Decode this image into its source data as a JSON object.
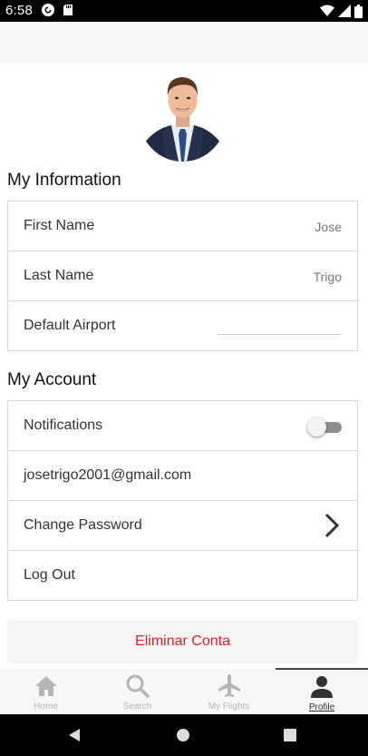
{
  "status_bar": {
    "time": "6:58",
    "left_icons": [
      "pocket-casts-icon",
      "sd-card-icon"
    ],
    "right_icons": [
      "wifi-icon",
      "signal-icon",
      "battery-icon"
    ]
  },
  "my_information": {
    "title": "My Information",
    "first_name": {
      "label": "First Name",
      "value": "Jose"
    },
    "last_name": {
      "label": "Last Name",
      "value": "Trigo"
    },
    "default_airport": {
      "label": "Default Airport",
      "value": ""
    }
  },
  "my_account": {
    "title": "My Account",
    "notifications": {
      "label": "Notifications",
      "enabled": false
    },
    "email": "josetrigo2001@gmail.com",
    "change_password": "Change Password",
    "log_out": "Log Out"
  },
  "delete_account": "Eliminar Conta",
  "tabs": [
    {
      "label": "Home",
      "icon": "home-icon",
      "active": false
    },
    {
      "label": "Search",
      "icon": "search-icon",
      "active": false
    },
    {
      "label": "My Flights",
      "icon": "airplane-icon",
      "active": false
    },
    {
      "label": "Profile",
      "icon": "person-icon",
      "active": true
    }
  ],
  "colors": {
    "danger": "#e0202a",
    "tab_inactive": "#b5b5b5",
    "tab_active": "#333333"
  }
}
